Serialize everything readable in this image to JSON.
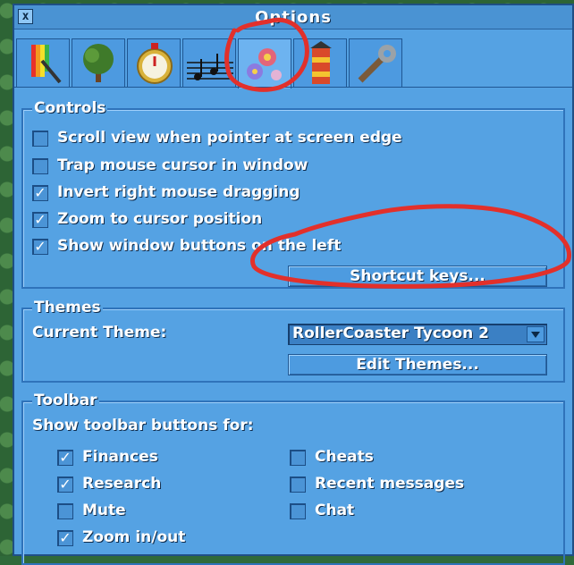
{
  "window": {
    "title": "Options",
    "close_label": "x"
  },
  "tabs": [
    {
      "icon": "display-tab-icon"
    },
    {
      "icon": "tree-tab-icon"
    },
    {
      "icon": "stopwatch-tab-icon"
    },
    {
      "icon": "music-tab-icon"
    },
    {
      "icon": "controls-flower-tab-icon",
      "active": true
    },
    {
      "icon": "lighthouse-tab-icon"
    },
    {
      "icon": "wrench-tab-icon"
    }
  ],
  "controls": {
    "title": "Controls",
    "options": [
      {
        "label": "Scroll view when pointer at screen edge",
        "checked": false
      },
      {
        "label": "Trap mouse cursor in window",
        "checked": false
      },
      {
        "label": "Invert right mouse dragging",
        "checked": true
      },
      {
        "label": "Zoom to cursor position",
        "checked": true
      },
      {
        "label": "Show window buttons on the left",
        "checked": true
      }
    ],
    "shortcut_button": "Shortcut keys..."
  },
  "themes": {
    "title": "Themes",
    "current_label": "Current Theme:",
    "current_value": "RollerCoaster Tycoon 2",
    "edit_button": "Edit Themes..."
  },
  "toolbar": {
    "title": "Toolbar",
    "subtitle": "Show toolbar buttons for:",
    "left": [
      {
        "label": "Finances",
        "checked": true
      },
      {
        "label": "Research",
        "checked": true
      },
      {
        "label": "Mute",
        "checked": false
      },
      {
        "label": "Zoom in/out",
        "checked": true
      }
    ],
    "right": [
      {
        "label": "Cheats",
        "checked": false
      },
      {
        "label": "Recent messages",
        "checked": false
      },
      {
        "label": "Chat",
        "checked": false
      }
    ]
  },
  "colors": {
    "panel": "#55a2e3",
    "annotation": "#e2302b"
  }
}
